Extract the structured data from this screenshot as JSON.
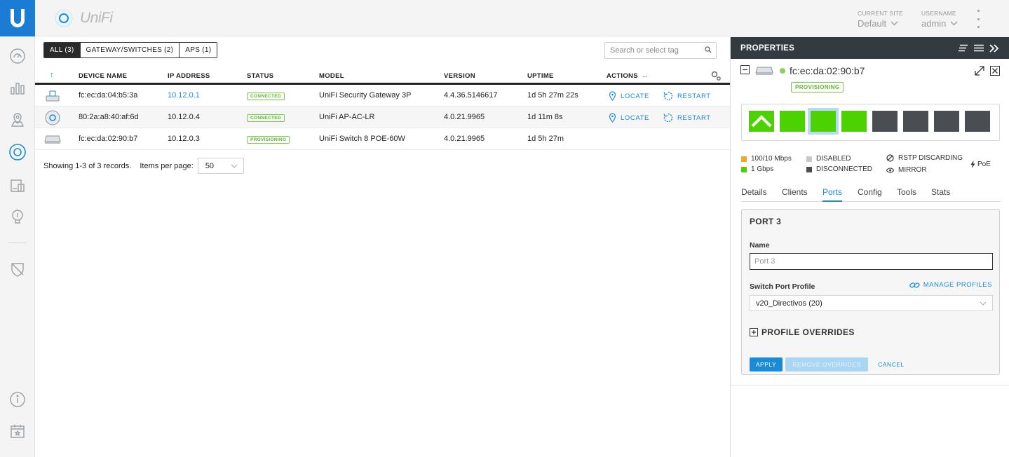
{
  "brand": {
    "name": "UniFi"
  },
  "header": {
    "site_caption": "CURRENT SITE",
    "site_value": "Default",
    "user_caption": "USERNAME",
    "user_value": "admin"
  },
  "filters": [
    {
      "label": "ALL (3)",
      "active": true
    },
    {
      "label": "GATEWAY/SWITCHES (2)",
      "active": false
    },
    {
      "label": "APS (1)",
      "active": false
    }
  ],
  "search": {
    "placeholder": "Search or select tag"
  },
  "table": {
    "sort_indicator": "↑",
    "columns": {
      "device_name": "DEVICE NAME",
      "ip": "IP ADDRESS",
      "status": "STATUS",
      "model": "MODEL",
      "version": "VERSION",
      "uptime": "UPTIME",
      "actions": "ACTIONS",
      "actions_arrows": "↔"
    },
    "rows": [
      {
        "name": "fc:ec:da:04:b5:3a",
        "ip": "10.12.0.1",
        "status": "CONNECTED",
        "model": "UniFi Security Gateway 3P",
        "version": "4.4.36.5146617",
        "uptime": "1d 5h 27m 22s",
        "locate": "LOCATE",
        "restart": "RESTART"
      },
      {
        "name": "80:2a:a8:40:af:6d",
        "ip": "10.12.0.4",
        "status": "CONNECTED",
        "model": "UniFi AP-AC-LR",
        "version": "4.0.21.9965",
        "uptime": "1d 11m 8s",
        "locate": "LOCATE",
        "restart": "RESTART"
      },
      {
        "name": "fc:ec:da:02:90:b7",
        "ip": "10.12.0.3",
        "status": "PROVISIONING",
        "model": "UniFi Switch 8 POE-60W",
        "version": "4.0.21.9965",
        "uptime": "1d 5h 27m"
      }
    ]
  },
  "footer": {
    "records": "Showing 1-3 of 3 records.",
    "items_per_page_label": "Items per page:",
    "items_per_page": "50"
  },
  "properties": {
    "title": "PROPERTIES",
    "device_name": "fc:ec:da:02:90:b7",
    "device_status": "PROVISIONING",
    "ports": [
      "uplink",
      "up",
      "up-selected",
      "up",
      "off",
      "off",
      "off",
      "off"
    ],
    "legend": {
      "speed_100": "100/10 Mbps",
      "speed_1g": "1 Gbps",
      "disabled": "DISABLED",
      "disconnected": "DISCONNECTED",
      "rstp": "RSTP DISCARDING",
      "mirror": "MIRROR",
      "poe": "PoE"
    },
    "tabs": [
      "Details",
      "Clients",
      "Ports",
      "Config",
      "Tools",
      "Stats"
    ],
    "active_tab": "Ports",
    "port_form": {
      "title": "PORT 3",
      "name_label": "Name",
      "name_placeholder": "Port 3",
      "name_value": "",
      "profile_label": "Switch Port Profile",
      "manage_profiles": "MANAGE PROFILES",
      "profile_value": "v20_Directivos (20)",
      "overrides": "PROFILE OVERRIDES",
      "apply": "APPLY",
      "remove_overrides": "REMOVE OVERRIDES",
      "cancel": "CANCEL"
    }
  },
  "colors": {
    "brand_blue": "#1b7cd6",
    "link_blue": "#1b8bd6",
    "port_up_green": "#4cd200",
    "port_off": "#4a4d52",
    "status_green": "#5cb82a",
    "legend_orange": "#f5a623"
  }
}
